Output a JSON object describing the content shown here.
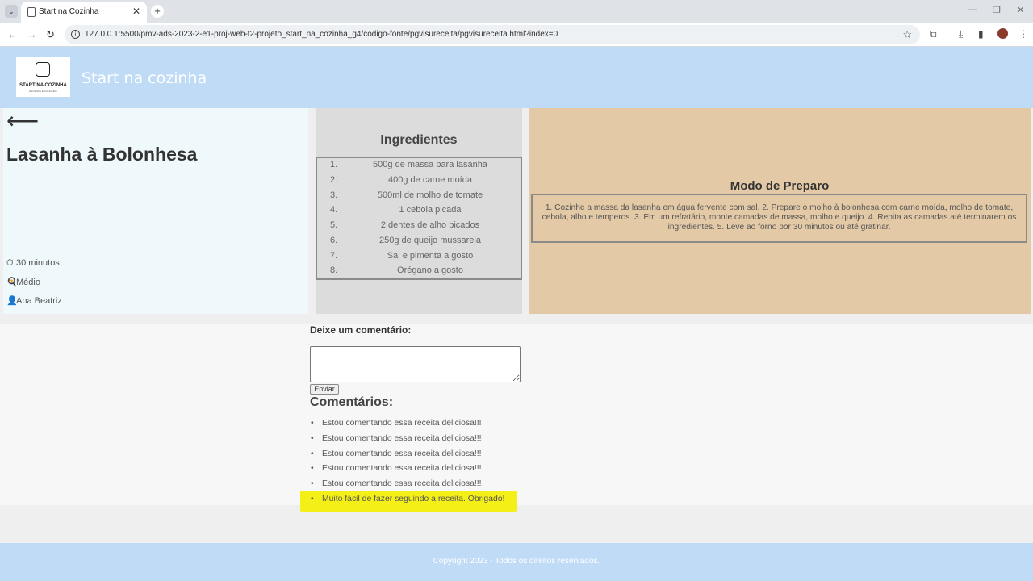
{
  "browser": {
    "tab_title": "Start na Cozinha",
    "url": "127.0.0.1:5500/pmv-ads-2023-2-e1-proj-web-t2-projeto_start_na_cozinha_g4/codigo-fonte/pgvisureceita/pgvisureceita.html?index=0"
  },
  "site": {
    "logo_text": "START NA COZINHA",
    "logo_subtext": "RECEITAS E CULINÁRIA",
    "title": "Start na cozinha"
  },
  "recipe": {
    "title": "Lasanha à Bolonhesa",
    "time": "30 minutos",
    "difficulty": "Médio",
    "author": "Ana Beatriz"
  },
  "ingredients": {
    "heading": "Ingredientes",
    "items": [
      {
        "num": "1.",
        "text": "500g de massa para lasanha"
      },
      {
        "num": "2.",
        "text": "400g de carne moída"
      },
      {
        "num": "3.",
        "text": "500ml de molho de tomate"
      },
      {
        "num": "4.",
        "text": "1 cebola picada"
      },
      {
        "num": "5.",
        "text": "2 dentes de alho picados"
      },
      {
        "num": "6.",
        "text": "250g de queijo mussarela"
      },
      {
        "num": "7.",
        "text": "Sal e pimenta a gosto"
      },
      {
        "num": "8.",
        "text": "Orégano a gosto"
      }
    ]
  },
  "preparation": {
    "heading": "Modo de Preparo",
    "text": "1. Cozinhe a massa da lasanha em água fervente com sal. 2. Prepare o molho à bolonhesa com carne moída, molho de tomate, cebola, alho e temperos. 3. Em um refratário, monte camadas de massa, molho e queijo. 4. Repita as camadas até terminarem os ingredientes. 5. Leve ao forno por 30 minutos ou até gratinar."
  },
  "comments": {
    "label": "Deixe um comentário:",
    "send_label": "Enviar",
    "heading": "Comentários:",
    "items": [
      "Estou comentando essa receita deliciosa!!!",
      "Estou comentando essa receita deliciosa!!!",
      "Estou comentando essa receita deliciosa!!!",
      "Estou comentando essa receita deliciosa!!!",
      "Estou comentando essa receita deliciosa!!!",
      "Muito fácil de fazer seguindo a receita. Obrigado!"
    ],
    "highlight_color": "#f5ef18"
  },
  "footer": {
    "text": "Copyright 2023 - Todos os direitos reservados."
  },
  "colors": {
    "header_bg": "#c0dbf6",
    "left_panel_bg": "#eff9fc",
    "ingredients_bg": "#dcdcdc",
    "preparation_bg": "#e3c9a6"
  }
}
